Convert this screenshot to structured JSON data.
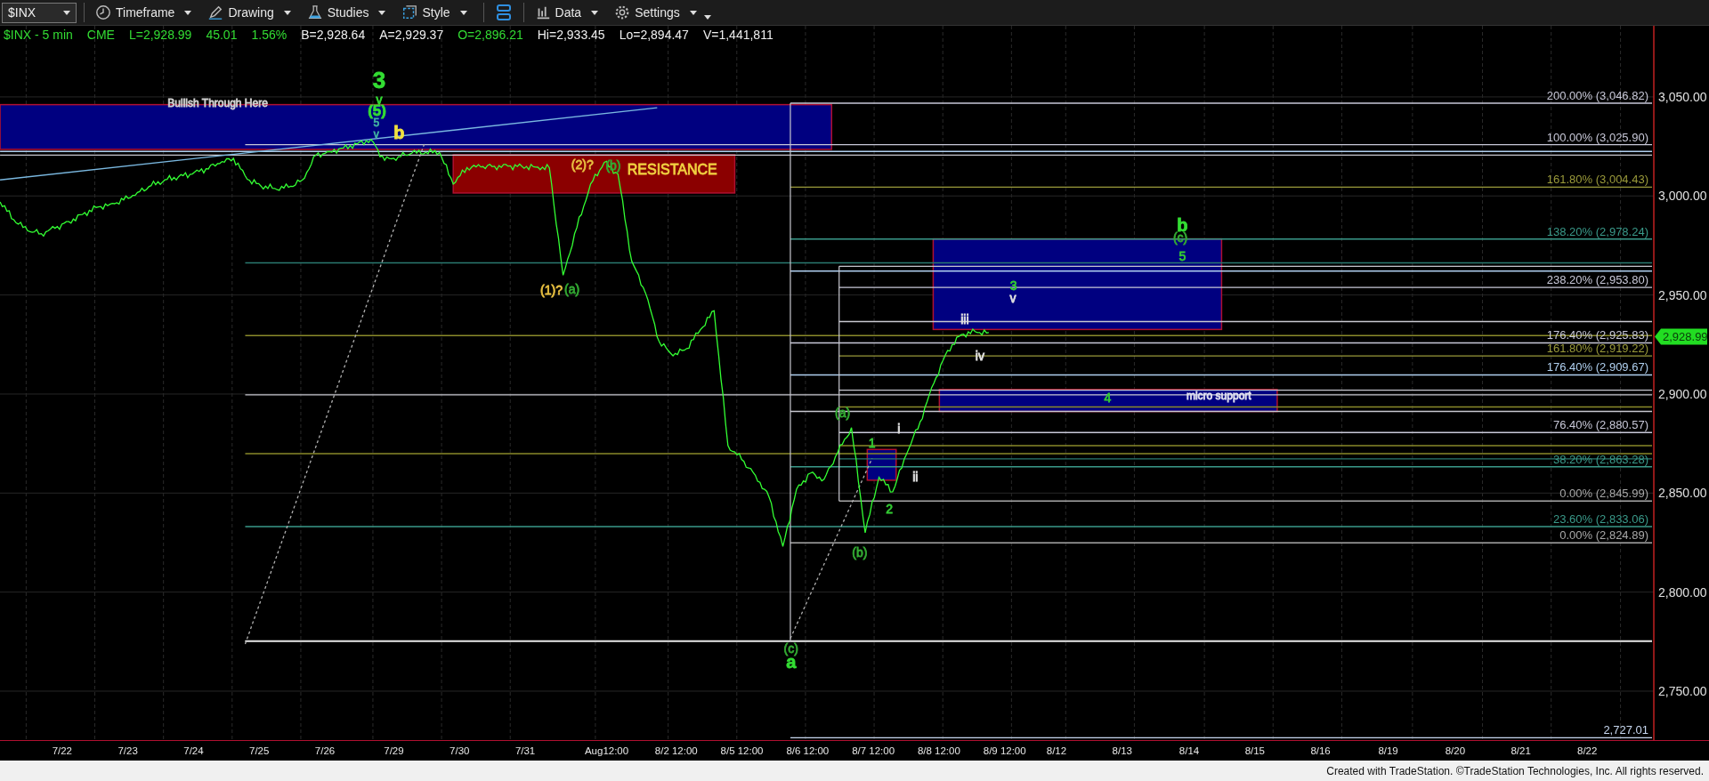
{
  "toolbar": {
    "symbol": "$INX",
    "buttons": [
      {
        "label": "Timeframe"
      },
      {
        "label": "Drawing"
      },
      {
        "label": "Studies"
      },
      {
        "label": "Style"
      },
      {
        "label": "Data"
      },
      {
        "label": "Settings"
      }
    ]
  },
  "quote_bar": [
    {
      "text": "$INX - 5 min",
      "color": "#33dd33"
    },
    {
      "text": "CME",
      "color": "#33dd33"
    },
    {
      "text": "L=2,928.99",
      "color": "#33dd33"
    },
    {
      "text": "45.01",
      "color": "#33dd33"
    },
    {
      "text": "1.56%",
      "color": "#33dd33"
    },
    {
      "text": "B=2,928.64",
      "color": "#f0f0f0"
    },
    {
      "text": "A=2,929.37",
      "color": "#f0f0f0"
    },
    {
      "text": "O=2,896.21",
      "color": "#33dd33"
    },
    {
      "text": "Hi=2,933.45",
      "color": "#f0f0f0"
    },
    {
      "text": "Lo=2,894.47",
      "color": "#f0f0f0"
    },
    {
      "text": "V=1,441,811",
      "color": "#f0f0f0"
    }
  ],
  "chart": {
    "price_axis": [
      "3,050.00",
      "3,000.00",
      "2,950.00",
      "2,900.00",
      "2,850.00",
      "2,800.00",
      "2,750.00"
    ],
    "wave_labels": [
      {
        "text": "Bullish Through Here",
        "color": "#d0d0d0",
        "kind": "caption"
      },
      {
        "text": "3",
        "color": "#33dd33",
        "kind": "large"
      },
      {
        "text": "v",
        "color": "#33dd33",
        "kind": "normal"
      },
      {
        "text": "(5)",
        "color": "#33dd33",
        "kind": "medium"
      },
      {
        "text": "5",
        "color": "#40b0a0",
        "kind": "caption"
      },
      {
        "text": "v",
        "color": "#40b0a0",
        "kind": "caption"
      },
      {
        "text": "b",
        "color": "#f0e040",
        "kind": "bold"
      },
      {
        "text": "(2)?",
        "color": "#e8c040",
        "kind": "normal"
      },
      {
        "text": "(b)",
        "color": "#33aa33",
        "kind": "normal"
      },
      {
        "text": "RESISTANCE",
        "color": "#f0d040",
        "kind": "heading"
      },
      {
        "text": "(1)?",
        "color": "#e8c040",
        "kind": "normal"
      },
      {
        "text": "(a)",
        "color": "#33aa33",
        "kind": "normal"
      },
      {
        "text": "(c)",
        "color": "#33aa33",
        "kind": "normal"
      },
      {
        "text": "a",
        "color": "#33dd33",
        "kind": "bold"
      },
      {
        "text": "(a)",
        "color": "#33aa33",
        "kind": "normal"
      },
      {
        "text": "1",
        "color": "#33cc33",
        "kind": "normal"
      },
      {
        "text": "i",
        "color": "#e0e0e0",
        "kind": "normal"
      },
      {
        "text": "ii",
        "color": "#e0e0e0",
        "kind": "normal"
      },
      {
        "text": "2",
        "color": "#33cc33",
        "kind": "normal"
      },
      {
        "text": "(b)",
        "color": "#33aa33",
        "kind": "normal"
      },
      {
        "text": "iii",
        "color": "#e0e0e0",
        "kind": "normal"
      },
      {
        "text": "iv",
        "color": "#e0e0e0",
        "kind": "normal"
      },
      {
        "text": "3",
        "color": "#33cc33",
        "kind": "normal"
      },
      {
        "text": "v",
        "color": "#e0e0e0",
        "kind": "normal"
      },
      {
        "text": "b",
        "color": "#33dd33",
        "kind": "bold"
      },
      {
        "text": "(c)",
        "color": "#33aa33",
        "kind": "normal"
      },
      {
        "text": "5",
        "color": "#33cc33",
        "kind": "normal"
      },
      {
        "text": "4",
        "color": "#33cc33",
        "kind": "normal"
      },
      {
        "text": "micro support",
        "color": "#e0e0f0",
        "kind": "caption"
      }
    ],
    "level_labels": [
      {
        "text": "200.00% (3,046.82)",
        "color": "#c8c8d8"
      },
      {
        "text": "100.00% (3,025.90)",
        "color": "#c8c8d8"
      },
      {
        "text": "161.80% (3,004.43)",
        "color": "#9a9a3a"
      },
      {
        "text": "138.20% (2,978.24)",
        "color": "#3a9a8a"
      },
      {
        "text": "238.20% (2,953.80)",
        "color": "#c8c8d8"
      },
      {
        "text": "176.40% (2,925.83)",
        "color": "#c8c8d8"
      },
      {
        "text": "161.80% (2,919.22)",
        "color": "#9a9a3a"
      },
      {
        "text": "176.40% (2,909.67)",
        "color": "#b0d0f0"
      },
      {
        "text": "76.40% (2,880.57)",
        "color": "#c8c8d8"
      },
      {
        "text": "38.20% (2,863.28)",
        "color": "#3a9a8a"
      },
      {
        "text": "0.00% (2,845.99)",
        "color": "#a8a8a8"
      },
      {
        "text": "23.60% (2,833.06)",
        "color": "#3a9a8a"
      },
      {
        "text": "0.00% (2,824.89)",
        "color": "#a8a8a8"
      },
      {
        "text": "2,727.01",
        "color": "#c8d8f0"
      }
    ],
    "last_price": "2,928.99"
  },
  "date_labels": [
    "7/22",
    "7/23",
    "7/24",
    "7/25",
    "7/26",
    "7/29",
    "7/30",
    "7/31",
    "Aug12:00",
    "8/2 12:00",
    "8/5 12:00",
    "8/6 12:00",
    "8/7 12:00",
    "8/8 12:00",
    "8/9 12:00",
    "8/12",
    "8/13",
    "8/14",
    "8/15",
    "8/16",
    "8/19",
    "8/20",
    "8/21",
    "8/22"
  ],
  "footer": "Created with TradeStation. ©TradeStation Technologies, Inc. All rights reserved."
}
